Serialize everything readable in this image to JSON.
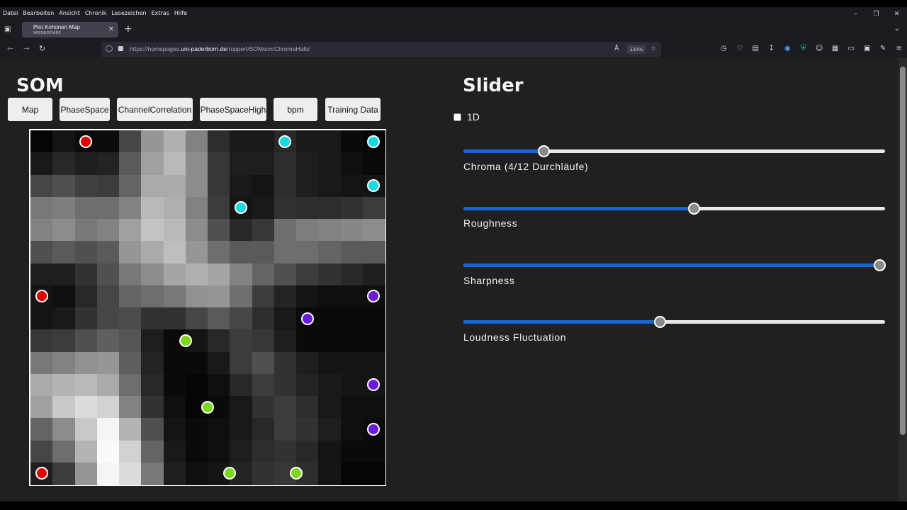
{
  "browser": {
    "menu": [
      "Datei",
      "Bearbeiten",
      "Ansicht",
      "Chronik",
      "Lesezeichen",
      "Extras",
      "Hilfe"
    ],
    "tab": {
      "title": "Plot Kohonen Map",
      "subtitle": "WIEDERGABE"
    },
    "url": {
      "prefix": "https://homepages.",
      "host": "uni-paderborn.de",
      "path": "/ruppert/SOMson/ChromaHalb/"
    },
    "zoom": "133%",
    "colors": {
      "chrome_bg": "#1c1b22",
      "tab_bg": "#42414d",
      "urlbar_bg": "#2b2a33"
    }
  },
  "som": {
    "title": "SOM",
    "buttons": [
      "Map",
      "PhaseSpace",
      "ChannelCorrelation",
      "PhaseSpaceHigh",
      "bpm",
      "Training Data"
    ],
    "grid_size": 16,
    "gray_levels": [
      [
        5,
        20,
        12,
        12,
        70,
        150,
        175,
        130,
        45,
        25,
        25,
        40,
        25,
        25,
        10,
        5
      ],
      [
        25,
        40,
        30,
        35,
        90,
        160,
        185,
        140,
        55,
        30,
        30,
        45,
        30,
        25,
        15,
        10
      ],
      [
        70,
        80,
        65,
        60,
        100,
        170,
        170,
        140,
        55,
        25,
        20,
        45,
        30,
        25,
        20,
        20
      ],
      [
        120,
        125,
        110,
        110,
        130,
        185,
        175,
        130,
        60,
        20,
        25,
        50,
        45,
        45,
        50,
        60
      ],
      [
        130,
        140,
        120,
        130,
        160,
        195,
        185,
        140,
        80,
        40,
        55,
        110,
        125,
        130,
        135,
        140
      ],
      [
        80,
        90,
        80,
        90,
        150,
        170,
        190,
        150,
        110,
        90,
        90,
        110,
        110,
        100,
        90,
        90
      ],
      [
        30,
        30,
        50,
        80,
        120,
        140,
        165,
        175,
        165,
        130,
        100,
        80,
        60,
        50,
        40,
        30
      ],
      [
        20,
        15,
        40,
        70,
        100,
        110,
        120,
        145,
        150,
        110,
        60,
        35,
        20,
        15,
        15,
        15
      ],
      [
        20,
        25,
        50,
        70,
        75,
        50,
        50,
        70,
        90,
        70,
        45,
        25,
        10,
        10,
        10,
        10
      ],
      [
        55,
        60,
        80,
        95,
        85,
        30,
        10,
        20,
        40,
        60,
        55,
        30,
        10,
        10,
        10,
        10
      ],
      [
        120,
        130,
        145,
        150,
        95,
        35,
        10,
        10,
        25,
        60,
        80,
        50,
        30,
        20,
        20,
        20
      ],
      [
        170,
        180,
        185,
        170,
        110,
        40,
        10,
        5,
        15,
        40,
        60,
        50,
        35,
        25,
        20,
        20
      ],
      [
        160,
        200,
        220,
        210,
        130,
        50,
        15,
        5,
        10,
        25,
        50,
        60,
        45,
        25,
        15,
        15
      ],
      [
        100,
        140,
        200,
        245,
        180,
        80,
        20,
        10,
        15,
        25,
        40,
        60,
        50,
        30,
        15,
        10
      ],
      [
        70,
        110,
        180,
        250,
        210,
        100,
        25,
        10,
        15,
        30,
        45,
        50,
        40,
        20,
        10,
        10
      ],
      [
        30,
        60,
        150,
        245,
        220,
        120,
        30,
        15,
        20,
        35,
        50,
        55,
        45,
        20,
        5,
        5
      ]
    ],
    "nodes": [
      {
        "col": 2,
        "row": 0,
        "color": "#e00000"
      },
      {
        "col": 11,
        "row": 0,
        "color": "#18d8e0"
      },
      {
        "col": 15,
        "row": 0,
        "color": "#18d8e0"
      },
      {
        "col": 15,
        "row": 2,
        "color": "#18d8e0"
      },
      {
        "col": 9,
        "row": 3,
        "color": "#18d8e0"
      },
      {
        "col": 0,
        "row": 7,
        "color": "#e00000"
      },
      {
        "col": 15,
        "row": 7,
        "color": "#6a1ad8"
      },
      {
        "col": 12,
        "row": 8,
        "color": "#6a1ad8"
      },
      {
        "col": 6.5,
        "row": 9,
        "color": "#7cd81a"
      },
      {
        "col": 15,
        "row": 11,
        "color": "#6a1ad8"
      },
      {
        "col": 7.5,
        "row": 12,
        "color": "#7cd81a"
      },
      {
        "col": 15,
        "row": 13,
        "color": "#6a1ad8"
      },
      {
        "col": 0,
        "row": 15,
        "color": "#e00000"
      },
      {
        "col": 8.5,
        "row": 15,
        "color": "#7cd81a"
      },
      {
        "col": 11.5,
        "row": 15,
        "color": "#7cd81a"
      }
    ]
  },
  "slider_panel": {
    "title": "Slider",
    "checkbox_label": "1D",
    "sliders": [
      {
        "label": "Chroma (4/12 Durchläufe)",
        "value": 0.19
      },
      {
        "label": "Roughness",
        "value": 0.546
      },
      {
        "label": "Sharpness",
        "value": 0.986
      },
      {
        "label": "Loudness Fluctuation",
        "value": 0.465
      }
    ],
    "colors": {
      "fill": "#1565d8",
      "track": "#e8e8e8",
      "thumb": "#8a8a8a"
    }
  }
}
